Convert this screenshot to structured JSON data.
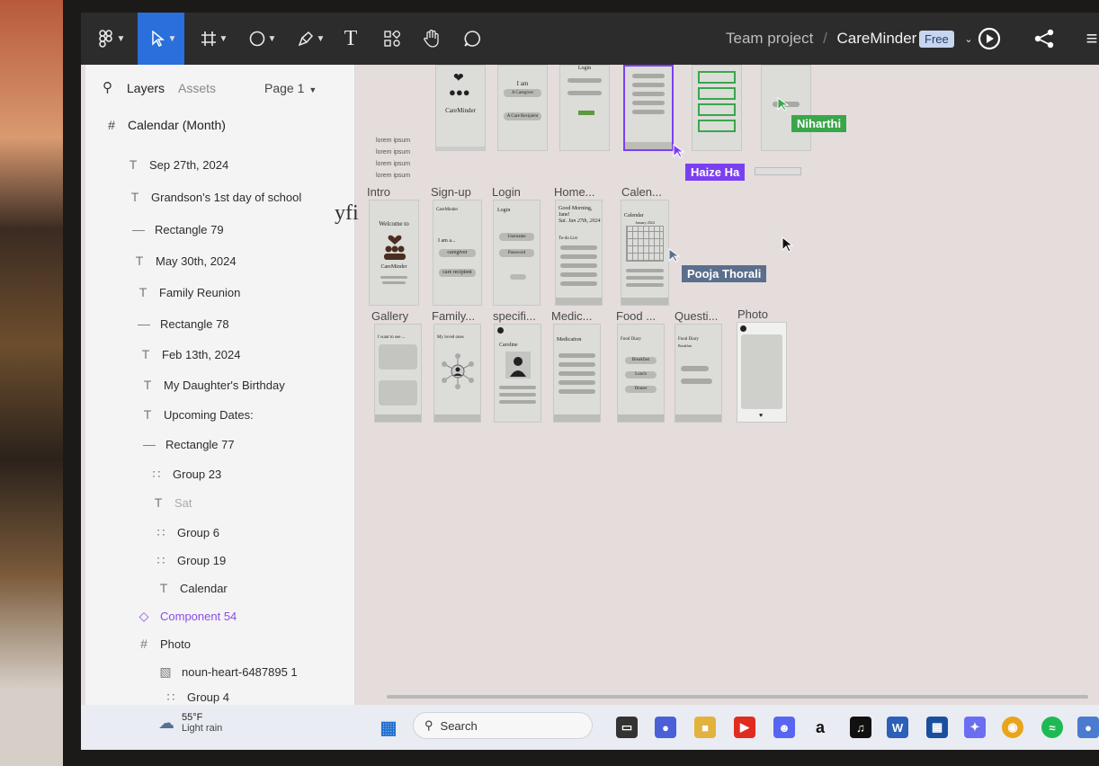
{
  "toolbar": {
    "breadcrumb_team": "Team project",
    "breadcrumb_sep": "/",
    "file_name": "CareMinder",
    "plan_badge": "Free"
  },
  "layers_panel": {
    "tab_layers": "Layers",
    "tab_assets": "Assets",
    "page_selector": "Page 1",
    "root_frame": "Calendar (Month)",
    "items": [
      {
        "icon": "text",
        "label": "Sep 27th, 2024"
      },
      {
        "icon": "text",
        "label": "Grandson's 1st day of school"
      },
      {
        "icon": "rect",
        "label": "Rectangle 79"
      },
      {
        "icon": "text",
        "label": "May 30th, 2024"
      },
      {
        "icon": "text",
        "label": "Family Reunion"
      },
      {
        "icon": "rect",
        "label": "Rectangle 78"
      },
      {
        "icon": "text",
        "label": "Feb 13th, 2024"
      },
      {
        "icon": "text",
        "label": "My Daughter's Birthday"
      },
      {
        "icon": "text",
        "label": "Upcoming Dates:"
      },
      {
        "icon": "rect",
        "label": "Rectangle 77"
      },
      {
        "icon": "group",
        "label": "Group 23"
      },
      {
        "icon": "text",
        "label": "Sat"
      },
      {
        "icon": "group",
        "label": "Group 6"
      },
      {
        "icon": "group",
        "label": "Group 19"
      },
      {
        "icon": "text",
        "label": "Calendar"
      },
      {
        "icon": "component",
        "label": "Component 54"
      },
      {
        "icon": "frame",
        "label": "Photo"
      },
      {
        "icon": "image",
        "label": "noun-heart-6487895 1"
      },
      {
        "icon": "group",
        "label": "Group 4"
      }
    ]
  },
  "canvas": {
    "stray_text": "yfi",
    "lorem_lines": [
      "lorem ipsum",
      "lorem ipsum",
      "lorem ipsum",
      "lorem ipsum"
    ],
    "top_frames": {
      "careminder_title": "CareMinder",
      "i_am": "I am",
      "caregiver_btn": "A Caregiver",
      "recipient_btn": "A Care Recipient",
      "login_title": "Login"
    },
    "row2_labels": [
      "Intro",
      "Sign-up",
      "Login",
      "Home...",
      "Calen..."
    ],
    "row3_labels": [
      "Gallery",
      "Family...",
      "specifi...",
      "Medic...",
      "Food ...",
      "Questi...",
      "Photo"
    ],
    "frames": {
      "intro_welcome": "Welcome to",
      "intro_app": "CareMinder",
      "signup_app": "CareMinder",
      "signup_iam": "I am a...",
      "signup_caregiver": "caregiver",
      "signup_recipient": "care recipient",
      "login_title": "Login",
      "login_username": "Username",
      "login_password": "Password",
      "home_greeting": "Good Morning, Jane!",
      "home_date": "Sat. Jan 27th, 2024",
      "home_todo": "To-do List",
      "calendar_title": "Calendar",
      "calendar_month": "January 2024",
      "gallery_title": "I want to see ...",
      "family_title": "My loved ones",
      "specific_name": "Caroline",
      "medic_title": "Medication",
      "food_title": "Food Diary",
      "food_breakfast": "Breakfast",
      "food_lunch": "Lunch",
      "food_dinner": "Dinner",
      "quest_title": "Food Diary",
      "quest_sub": "Breakfast"
    },
    "collaborators": [
      {
        "name": "Haize Ha",
        "color": "#7b3ff2"
      },
      {
        "name": "Pooja Thorali",
        "color": "#5a6f8c"
      },
      {
        "name": "Niharthi",
        "color": "#3aa64a"
      }
    ]
  },
  "taskbar": {
    "weather_temp": "55°F",
    "weather_desc": "Light rain",
    "search_label": "Search"
  }
}
